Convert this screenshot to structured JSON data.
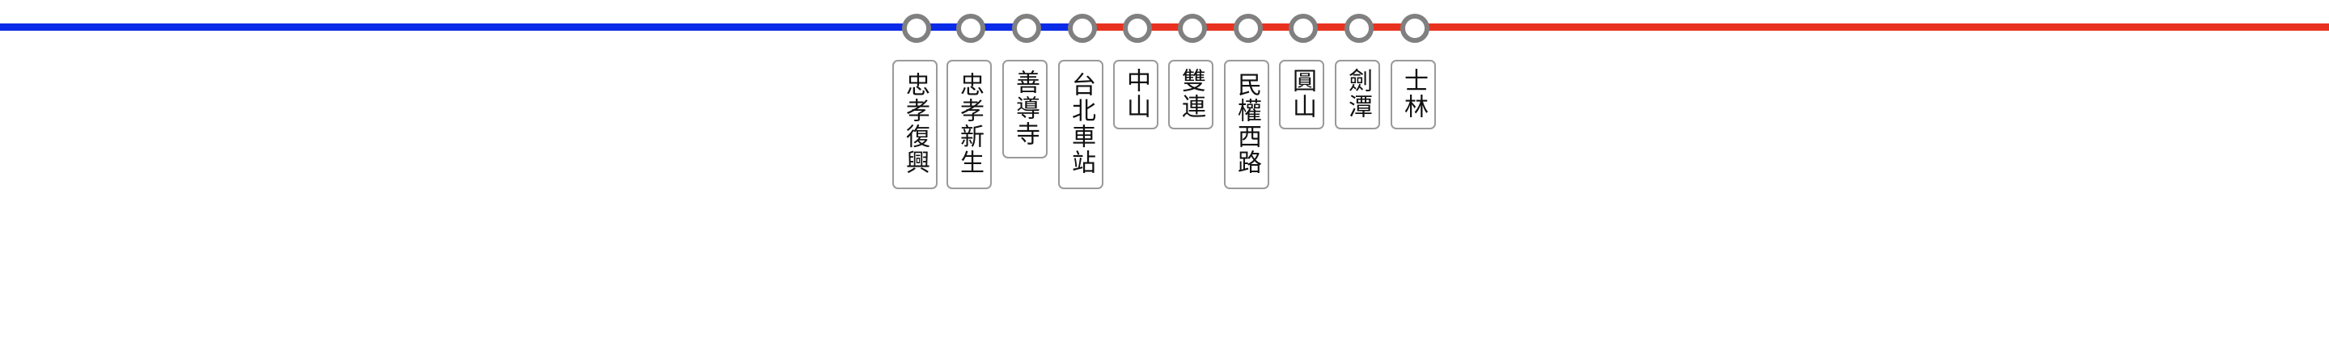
{
  "lines": {
    "left_color": "#0a2be8",
    "right_color": "#e8321f"
  },
  "stations": [
    {
      "name": "忠孝復興",
      "segment_color_after": "#0a2be8"
    },
    {
      "name": "忠孝新生",
      "segment_color_after": "#0a2be8"
    },
    {
      "name": "善導寺",
      "segment_color_after": "#0a2be8"
    },
    {
      "name": "台北車站",
      "segment_color_after": "#e8321f"
    },
    {
      "name": "中山",
      "segment_color_after": "#e8321f"
    },
    {
      "name": "雙連",
      "segment_color_after": "#e8321f"
    },
    {
      "name": "民權西路",
      "segment_color_after": "#e8321f"
    },
    {
      "name": "圓山",
      "segment_color_after": "#e8321f"
    },
    {
      "name": "劍潭",
      "segment_color_after": "#e8321f"
    },
    {
      "name": "士林",
      "segment_color_after": "#e8321f"
    }
  ],
  "marker_color": "#808080"
}
